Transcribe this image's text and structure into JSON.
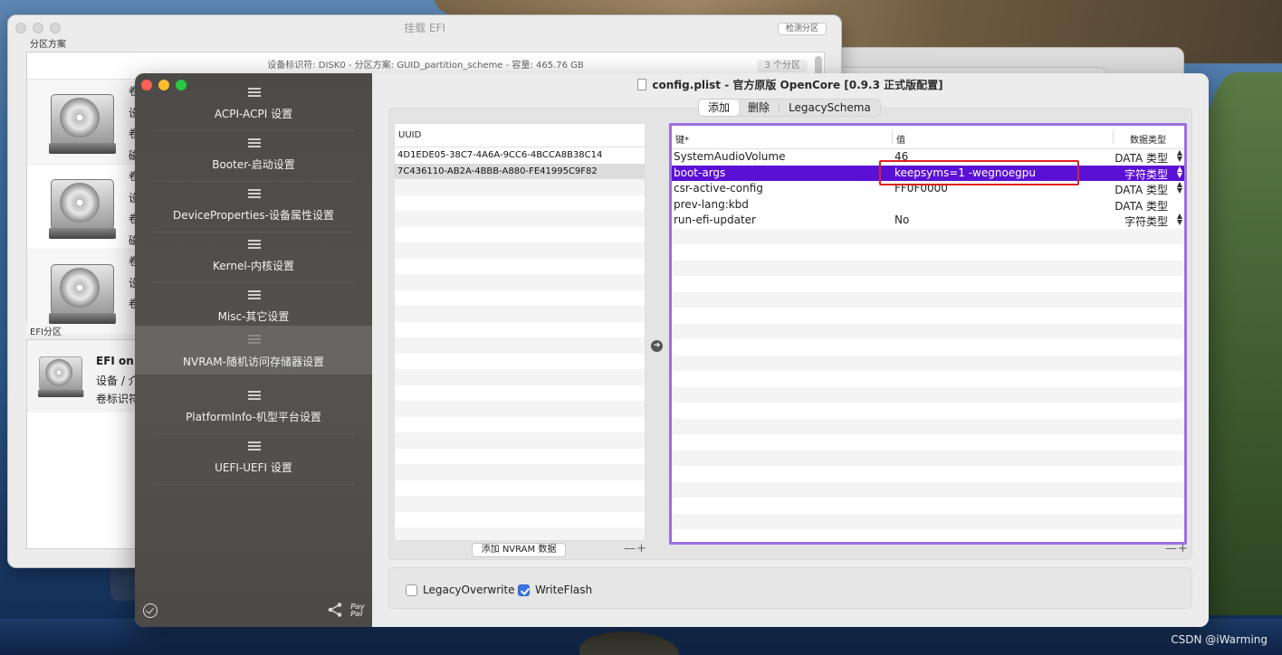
{
  "back_window": {
    "title": "挂载 EFI",
    "detect_button": "检测分区",
    "partition_section_label": "分区方案",
    "disk_header": "设备标识符: DISK0 - 分区方案: GUID_partition_scheme - 容量: 465.76 GB",
    "partition_count": "3 个分区",
    "disk_rows": [
      {
        "lines": [
          "卷",
          "设",
          "卷",
          "磁"
        ]
      },
      {
        "lines": [
          "卷",
          "设",
          "卷",
          "磁"
        ]
      },
      {
        "lines": [
          "卷",
          "设",
          "卷"
        ]
      }
    ],
    "efi_section_label": "EFI分区",
    "efi_title": "EFI on A",
    "efi_line1": "设备 / 介",
    "efi_line2": "卷标识符"
  },
  "main_window": {
    "title": "config.plist - 官方原版 OpenCore [0.9.3 正式版配置]",
    "sidebar": {
      "items": [
        {
          "label": "ACPI-ACPI 设置"
        },
        {
          "label": "Booter-启动设置"
        },
        {
          "label": "DeviceProperties-设备属性设置"
        },
        {
          "label": "Kernel-内核设置"
        },
        {
          "label": "Misc-其它设置"
        },
        {
          "label": "NVRAM-随机访问存储器设置"
        },
        {
          "label": "PlatformInfo-机型平台设置"
        },
        {
          "label": "UEFI-UEFI 设置"
        }
      ],
      "active_index": 5,
      "paypal_text": "Pay Pal",
      "icons": {
        "check": "check-circle-icon",
        "share": "share-icon",
        "paypal": "paypal-icon"
      }
    },
    "tabs": [
      "添加",
      "删除",
      "LegacySchema"
    ],
    "selected_tab": "添加",
    "uuid_list": {
      "header": "UUID",
      "rows": [
        "4D1EDE05-38C7-4A6A-9CC6-4BCCA8B38C14",
        "7C436110-AB2A-4BBB-A880-FE41995C9F82"
      ],
      "selected_index": 1,
      "add_button": "添加 NVRAM 数据",
      "minus_plus": "—+"
    },
    "kv_table": {
      "headers": {
        "key": "键*",
        "value": "值",
        "type": "数据类型"
      },
      "rows": [
        {
          "key": "SystemAudioVolume",
          "value": "46",
          "type": "DATA 类型"
        },
        {
          "key": "boot-args",
          "value": "keepsyms=1  -wegnoegpu",
          "type": "字符类型"
        },
        {
          "key": "csr-active-config",
          "value": "FF0F0000",
          "type": "DATA 类型"
        },
        {
          "key": "prev-lang:kbd",
          "value": "",
          "type": "DATA 类型"
        },
        {
          "key": "run-efi-updater",
          "value": "No",
          "type": "字符类型"
        }
      ],
      "selected_index": 1,
      "highlight_color": "#5b10d6",
      "border_color": "#9c6fe0",
      "annotation_color": "#e02020",
      "minus_plus": "—+"
    },
    "options": {
      "legacy_overwrite": {
        "label": "LegacyOverwrite",
        "checked": false
      },
      "write_flash": {
        "label": "WriteFlash",
        "checked": true
      }
    }
  },
  "watermark": "CSDN @iWarming"
}
